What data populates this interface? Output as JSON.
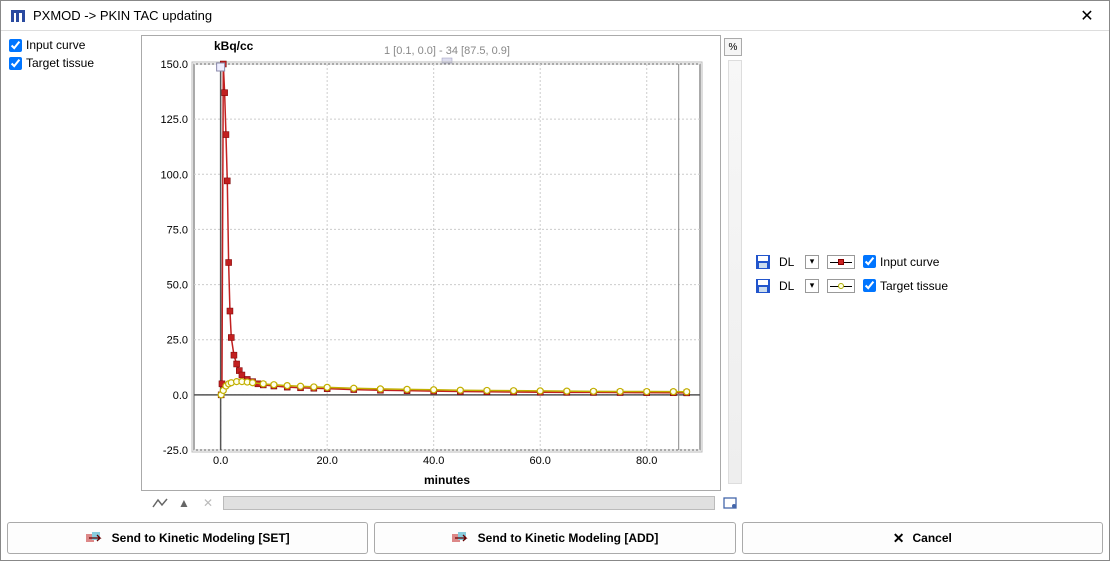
{
  "window": {
    "title": "PXMOD -> PKIN TAC updating",
    "close_glyph": "✕"
  },
  "sidebar": {
    "items": [
      {
        "label": "Input curve",
        "checked": true
      },
      {
        "label": "Target tissue",
        "checked": true
      }
    ]
  },
  "chart_caption": "1 [0.1, 0.0] - 34 [87.5, 0.9]",
  "chart_data": {
    "type": "line",
    "title": "",
    "ylabel": "kBq/cc",
    "xlabel": "minutes",
    "xlim": [
      -5,
      90
    ],
    "ylim": [
      -25,
      150
    ],
    "xticks": [
      0.0,
      20.0,
      40.0,
      60.0,
      80.0
    ],
    "yticks": [
      -25.0,
      0.0,
      25.0,
      50.0,
      75.0,
      100.0,
      125.0,
      150.0
    ],
    "series": [
      {
        "name": "Input curve",
        "color": "#c22020",
        "marker": "square",
        "x": [
          0.1,
          0.25,
          0.5,
          0.75,
          1,
          1.25,
          1.5,
          1.75,
          2,
          2.5,
          3,
          3.5,
          4,
          5,
          6,
          7,
          8,
          10,
          12.5,
          15,
          17.5,
          20,
          25,
          30,
          35,
          40,
          45,
          50,
          55,
          60,
          65,
          70,
          75,
          80,
          85,
          87.5
        ],
        "y": [
          0,
          5,
          150,
          137,
          118,
          97,
          60,
          38,
          26,
          18,
          14,
          11,
          9,
          7,
          6,
          5,
          4.5,
          4,
          3.5,
          3.2,
          3,
          2.8,
          2.4,
          2.1,
          1.9,
          1.7,
          1.5,
          1.4,
          1.3,
          1.2,
          1.15,
          1.1,
          1.05,
          1.0,
          0.95,
          0.9
        ]
      },
      {
        "name": "Target tissue",
        "color": "#c2b000",
        "marker": "circle",
        "x": [
          0.1,
          0.5,
          1,
          1.5,
          2,
          3,
          4,
          5,
          6,
          8,
          10,
          12.5,
          15,
          17.5,
          20,
          25,
          30,
          35,
          40,
          45,
          50,
          55,
          60,
          65,
          70,
          75,
          80,
          85,
          87.5
        ],
        "y": [
          0,
          2,
          4,
          5,
          5.5,
          6,
          6,
          5.8,
          5.5,
          5,
          4.6,
          4.2,
          3.9,
          3.6,
          3.4,
          3.0,
          2.7,
          2.5,
          2.3,
          2.1,
          2.0,
          1.9,
          1.8,
          1.7,
          1.6,
          1.55,
          1.5,
          1.45,
          1.4
        ]
      }
    ]
  },
  "legend": {
    "dl_label": "DL",
    "items": [
      {
        "label": "Input curve",
        "checked": true,
        "swatch": "red-square"
      },
      {
        "label": "Target tissue",
        "checked": true,
        "swatch": "yellow-circle"
      }
    ]
  },
  "chart_buttons": {
    "percent": "%",
    "expand_glyph": "⛶"
  },
  "buttons": {
    "set": "Send to Kinetic Modeling [SET]",
    "add": "Send to Kinetic Modeling [ADD]",
    "cancel": "Cancel"
  }
}
